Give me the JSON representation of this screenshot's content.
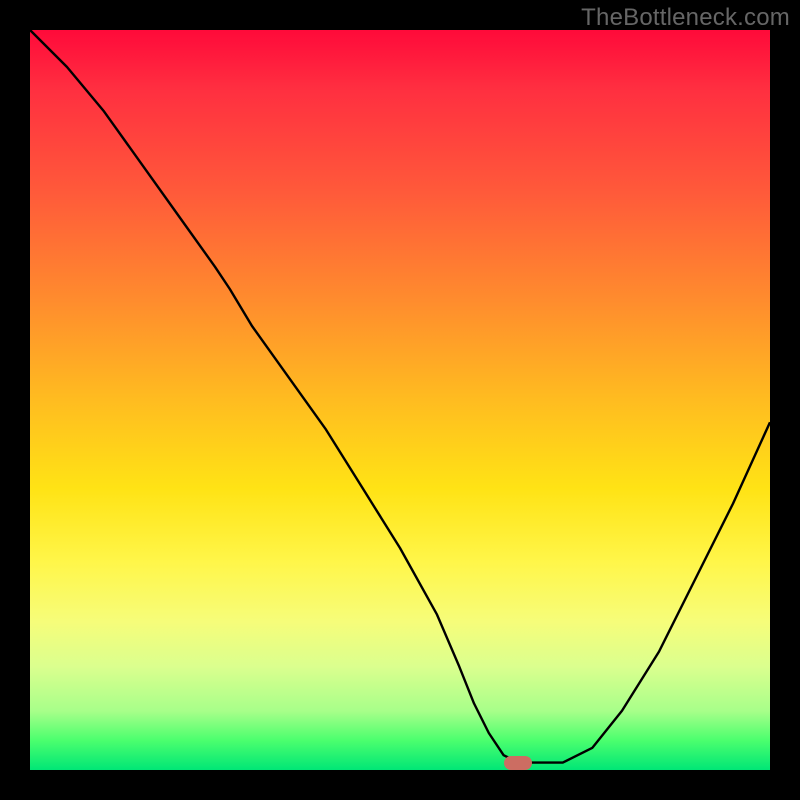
{
  "watermark": "TheBottleneck.com",
  "chart_data": {
    "type": "line",
    "title": "",
    "xlabel": "",
    "ylabel": "",
    "xlim": [
      0,
      100
    ],
    "ylim": [
      0,
      100
    ],
    "grid": false,
    "legend": false,
    "background": "rainbow-vertical-gradient",
    "series": [
      {
        "name": "bottleneck-curve",
        "x": [
          0,
          5,
          10,
          15,
          20,
          25,
          27,
          30,
          35,
          40,
          45,
          50,
          55,
          58,
          60,
          62,
          64,
          66,
          68,
          72,
          76,
          80,
          85,
          90,
          95,
          100
        ],
        "y": [
          100,
          95,
          89,
          82,
          75,
          68,
          65,
          60,
          53,
          46,
          38,
          30,
          21,
          14,
          9,
          5,
          2,
          1,
          1,
          1,
          3,
          8,
          16,
          26,
          36,
          47
        ]
      }
    ],
    "marker": {
      "x": 66,
      "y": 1,
      "shape": "rounded-pill",
      "color": "#cc6d62"
    }
  },
  "colors": {
    "frame": "#000000",
    "watermark": "#666666",
    "curve": "#000000"
  }
}
